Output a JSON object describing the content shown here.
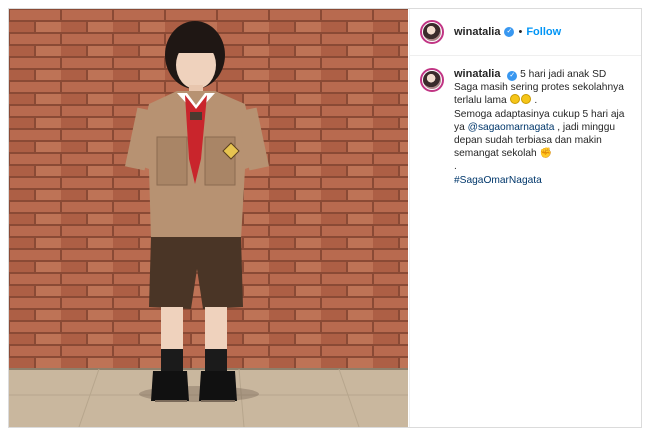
{
  "post": {
    "username": "winatalia",
    "follow_label": "Follow",
    "separator": "•",
    "caption": {
      "line1": "5 hari jadi anak SD",
      "line2": "Saga masih sering protes sekolahnya",
      "line3": "terlalu lama",
      "line4": ".",
      "line5": "Semoga adaptasinya cukup 5 hari aja",
      "line6_prefix": "ya",
      "mention": "@sagaomarnagata",
      "line6_suffix": ", jadi minggu",
      "line7": "depan sudah terbiasa dan makin",
      "line8": "semangat sekolah",
      "line9": ".",
      "hashtag": "#SagaOmarNagata"
    }
  },
  "colors": {
    "accent": "#0095f6",
    "link": "#00376b",
    "verified": "#3897f0"
  },
  "icons": [
    "verified-badge-icon",
    "grin-emoji-icon",
    "muscle-emoji-icon"
  ]
}
